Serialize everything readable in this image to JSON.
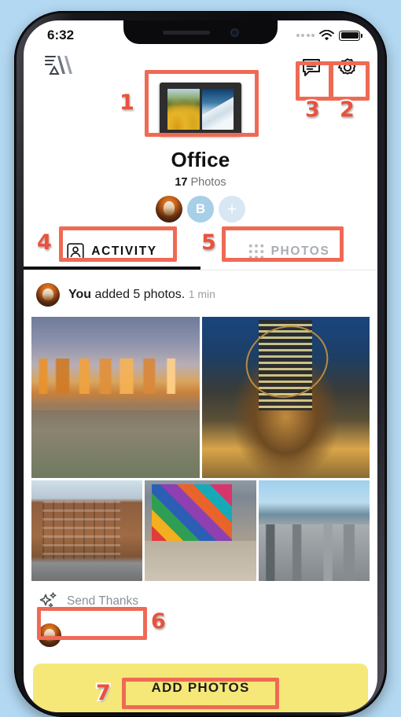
{
  "status_bar": {
    "time": "6:32",
    "signal_icon": "signal-dots-icon",
    "wifi_icon": "wifi-icon",
    "battery_icon": "battery-icon"
  },
  "header": {
    "brand_logo_icon": "aura-logo-icon",
    "chat_icon": "chat-bubble-icon",
    "settings_icon": "gear-icon"
  },
  "album": {
    "cover_icon": "digital-photo-frame-thumbnail",
    "title": "Office",
    "photo_count": "17",
    "photo_count_label": "Photos",
    "members": [
      {
        "name": "avatar-photo",
        "label": "",
        "type": "image"
      },
      {
        "name": "avatar-initial",
        "label": "B",
        "type": "initial"
      },
      {
        "name": "avatar-add",
        "label": "+",
        "type": "add"
      }
    ]
  },
  "tabs": [
    {
      "label": "ACTIVITY",
      "icon": "person-icon",
      "active": true
    },
    {
      "label": "PHOTOS",
      "icon": "grid-icon",
      "active": false
    }
  ],
  "feed": {
    "actor": "You",
    "action": " added 5 photos.",
    "time": "1 min",
    "photos": [
      {
        "name": "photo-sf-skyline-sunset",
        "alt": "San Francisco skyline at sunset"
      },
      {
        "name": "photo-atlas-statue",
        "alt": "Atlas statue at Rockefeller Center"
      },
      {
        "name": "photo-brick-hotel",
        "alt": "Brick hotel building on a corner"
      },
      {
        "name": "photo-kobra-mural",
        "alt": "Colorful geometric faces mural"
      },
      {
        "name": "photo-sf-aerial",
        "alt": "Aerial view of San Francisco and bay"
      }
    ],
    "thanks_label": "Send Thanks",
    "thanks_icon": "sparkles-icon"
  },
  "cta": {
    "label": "ADD PHOTOS"
  },
  "annotations": [
    {
      "num": "1",
      "target": "album-cover"
    },
    {
      "num": "2",
      "target": "settings-button"
    },
    {
      "num": "3",
      "target": "chat-button"
    },
    {
      "num": "4",
      "target": "tab-activity"
    },
    {
      "num": "5",
      "target": "tab-photos"
    },
    {
      "num": "6",
      "target": "send-thanks-button"
    },
    {
      "num": "7",
      "target": "add-photos-button"
    }
  ],
  "colors": {
    "accent_annotation": "#ef6a55",
    "cta_yellow": "#f5e878",
    "backdrop": "#b3d8f2",
    "avatar_blue": "#a7cfe8"
  }
}
